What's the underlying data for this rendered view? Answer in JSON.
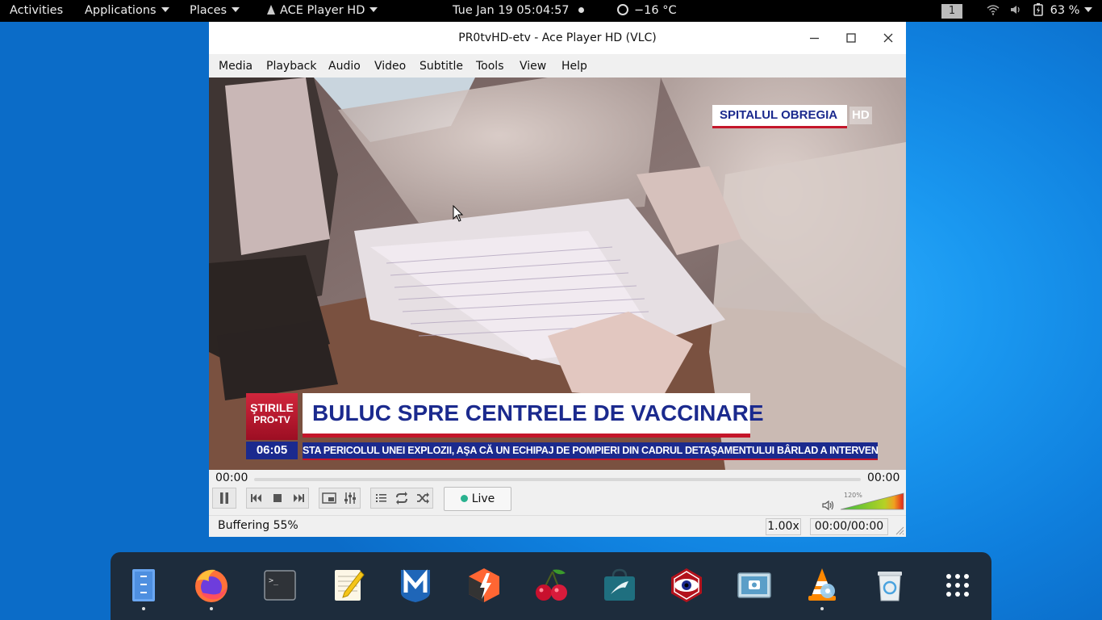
{
  "topbar": {
    "activities": "Activities",
    "applications": "Applications",
    "places": "Places",
    "app_name": "ACE Player HD",
    "clock": "Tue Jan 19  05:04:57",
    "weather": "−16 °C",
    "workspace": "1",
    "battery": "63 %"
  },
  "window": {
    "title": "PR0tvHD-etv - Ace Player HD (VLC)"
  },
  "menu": [
    "Media",
    "Playback",
    "Audio",
    "Video",
    "Subtitle",
    "Tools",
    "View",
    "Help"
  ],
  "video": {
    "location_tag": "SPITALUL OBREGIA",
    "quality_tag": "HD",
    "channel_logo_line1": "ŞTIRILE",
    "channel_logo_line2": "PRO•TV",
    "broadcast_time": "06:05",
    "headline": "BULUC SPRE CENTRELE DE VACCINARE",
    "ticker": "STA PERICOLUL UNEI EXPLOZII, AŞA CĂ UN ECHIPAJ DE POMPIERI DIN CADRUL DETAŞAMENTULUI BÂRLAD A INTERVENIT"
  },
  "controls": {
    "time_elapsed": "00:00",
    "time_total": "00:00",
    "live_label": "Live",
    "volume_label": "120%"
  },
  "status": {
    "buffering": "Buffering 55%",
    "speed": "1.00x",
    "time": "00:00/00:00"
  },
  "dock": {
    "icons": [
      "files-icon",
      "firefox-icon",
      "terminal-icon",
      "text-editor-icon",
      "metasploit-icon",
      "burpsuite-icon",
      "cherrytree-icon",
      "software-store-icon",
      "zenmap-icon",
      "screenshot-icon",
      "vlc-icon",
      "trash-icon",
      "app-grid-icon"
    ]
  }
}
